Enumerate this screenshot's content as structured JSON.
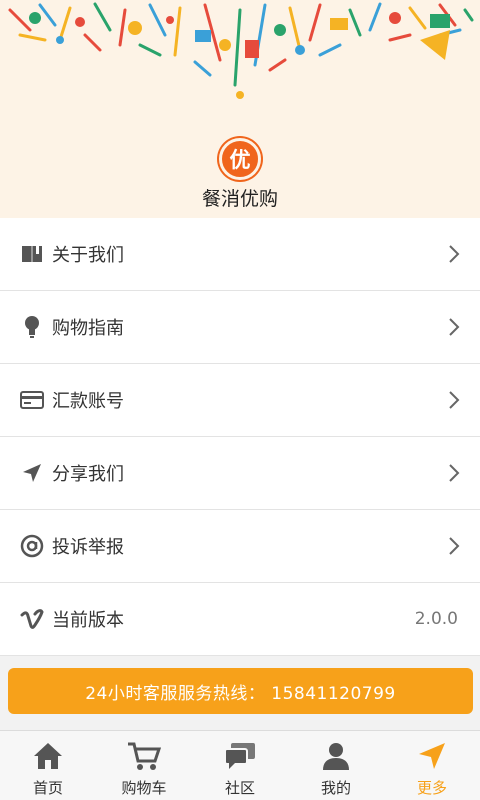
{
  "brand": {
    "badge_char": "优",
    "name": "餐消优购",
    "accent": "#f0651c"
  },
  "menu": {
    "items": [
      {
        "label": "关于我们",
        "icon": "book-icon"
      },
      {
        "label": "购物指南",
        "icon": "lightbulb-icon"
      },
      {
        "label": "汇款账号",
        "icon": "credit-card-icon"
      },
      {
        "label": "分享我们",
        "icon": "send-icon"
      },
      {
        "label": "投诉举报",
        "icon": "at-icon"
      },
      {
        "label": "当前版本",
        "icon": "vimeo-icon",
        "value": "2.0.0"
      }
    ]
  },
  "hotline": {
    "text": "24小时客服服务热线： 15841120799",
    "color": "#f7a11a"
  },
  "tabbar": {
    "active_color": "#f7a11a",
    "tabs": [
      {
        "label": "首页",
        "icon": "home-icon"
      },
      {
        "label": "购物车",
        "icon": "cart-icon"
      },
      {
        "label": "社区",
        "icon": "chat-icon"
      },
      {
        "label": "我的",
        "icon": "user-icon"
      },
      {
        "label": "更多",
        "icon": "send-icon",
        "active": true
      }
    ]
  }
}
